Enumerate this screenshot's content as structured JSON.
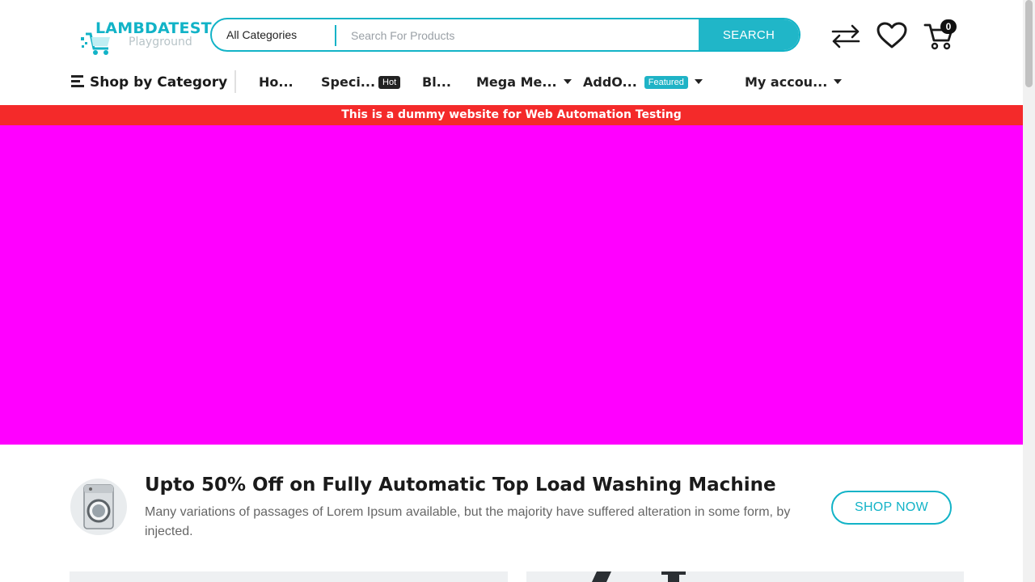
{
  "logo": {
    "brand": "LAMBDATEST",
    "sub": "Playground"
  },
  "search": {
    "category": "All Categories",
    "placeholder": "Search For Products",
    "button": "SEARCH"
  },
  "header": {
    "cart_count": "0",
    "icons": [
      "compare-icon",
      "wishlist-heart-icon",
      "cart-icon"
    ]
  },
  "nav": {
    "shop_by_category": "Shop by Category",
    "items": [
      {
        "label": "Ho..."
      },
      {
        "label": "Speci...",
        "badge": "Hot"
      },
      {
        "label": "Bl..."
      },
      {
        "label": "Mega Me..."
      },
      {
        "label": "AddO...",
        "badge": "Featured"
      },
      {
        "label": "My accou..."
      }
    ]
  },
  "notice": "This is a dummy website for Web Automation Testing",
  "promo": {
    "title": "Upto 50% Off on Fully Automatic Top Load Washing Machine",
    "description": "Many variations of passages of Lorem Ipsum available, but the majority have suffered alteration in some form, by injected.",
    "button": "SHOP NOW"
  },
  "colors": {
    "accent": "#12b3c7",
    "notice_bg": "#f42a2a",
    "hero_bg": "#ff00ff"
  }
}
